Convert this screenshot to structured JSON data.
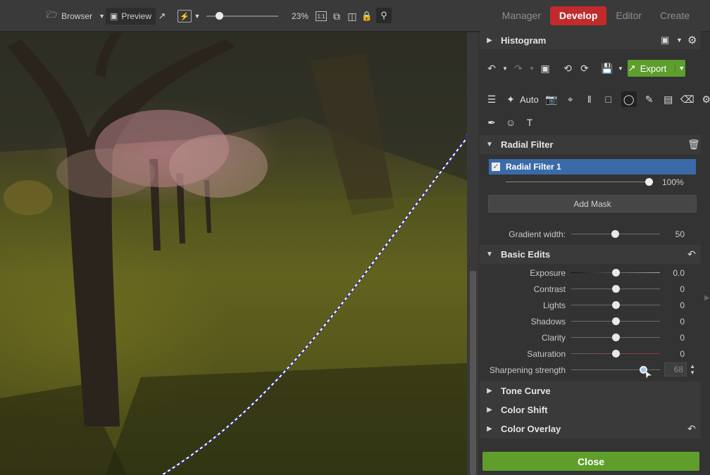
{
  "toolbar": {
    "browser_label": "Browser",
    "preview_label": "Preview",
    "zoom": "23%",
    "one_to_one": "1:1",
    "export_label": "Export",
    "modes": [
      "Manager",
      "Develop",
      "Editor",
      "Create"
    ],
    "auto_label": "Auto"
  },
  "panel": {
    "histogram": "Histogram",
    "radial_filter": "Radial Filter",
    "filter_item": "Radial Filter 1",
    "opacity": "100%",
    "opacity_fraction": 1.0,
    "add_mask": "Add Mask",
    "gradient_width_label": "Gradient width:",
    "gradient_width": "50",
    "gradient_width_fraction": 0.5,
    "basic_edits": "Basic Edits",
    "edits": [
      {
        "label": "Exposure",
        "value": "0.0",
        "fraction": 0.5
      },
      {
        "label": "Contrast",
        "value": "0",
        "fraction": 0.5
      },
      {
        "label": "Lights",
        "value": "0",
        "fraction": 0.5
      },
      {
        "label": "Shadows",
        "value": "0",
        "fraction": 0.5
      },
      {
        "label": "Clarity",
        "value": "0",
        "fraction": 0.5
      },
      {
        "label": "Saturation",
        "value": "0",
        "fraction": 0.5
      },
      {
        "label": "Sharpening strength",
        "value": "68",
        "fraction": 0.81
      }
    ],
    "tone_curve": "Tone Curve",
    "color_shift": "Color Shift",
    "color_overlay": "Color Overlay",
    "close": "Close"
  },
  "colors": {
    "accent_red": "#c12b2b",
    "export_green": "#5d9e2c",
    "close_green": "#5f9e2b",
    "selected_blue": "#3b6aa8"
  }
}
